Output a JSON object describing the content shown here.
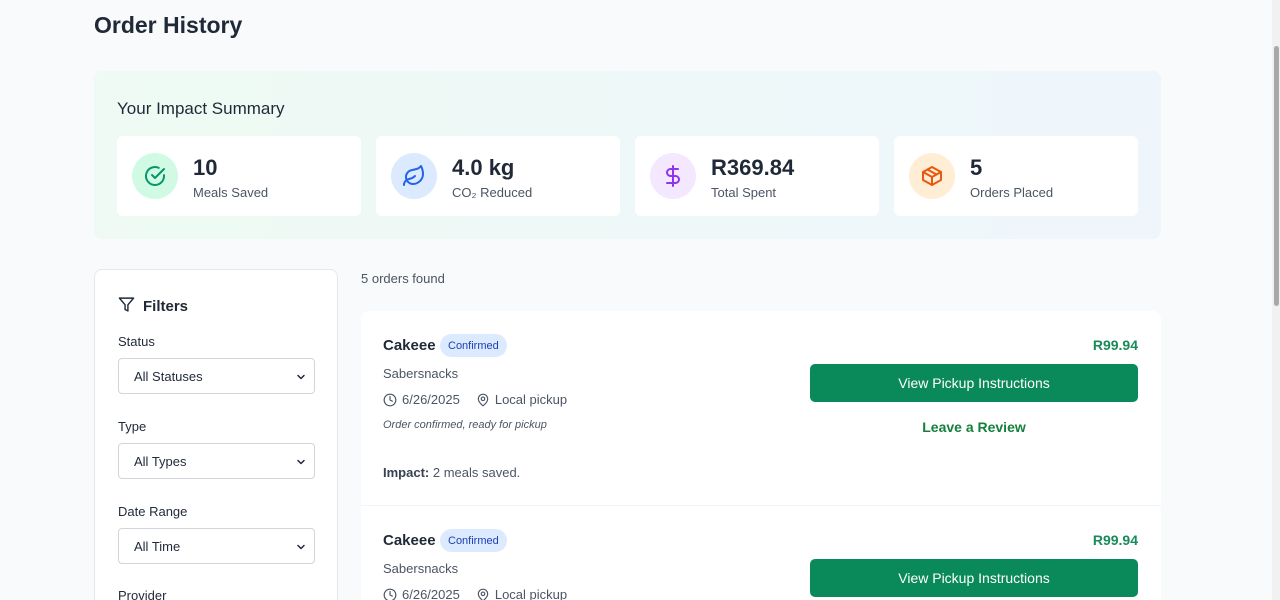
{
  "page": {
    "title": "Order History"
  },
  "impact": {
    "title": "Your Impact Summary",
    "stats": [
      {
        "value": "10",
        "label": "Meals Saved",
        "icon": "check-circle-icon",
        "bg": "#d1fae5",
        "fg": "#059669"
      },
      {
        "value": "4.0 kg",
        "label": "CO₂ Reduced",
        "icon": "leaf-icon",
        "bg": "#dbeafe",
        "fg": "#2563eb"
      },
      {
        "value": "R369.84",
        "label": "Total Spent",
        "icon": "dollar-icon",
        "bg": "#f3e8ff",
        "fg": "#9333ea"
      },
      {
        "value": "5",
        "label": "Orders Placed",
        "icon": "package-icon",
        "bg": "#ffedd5",
        "fg": "#ea580c"
      }
    ]
  },
  "filters": {
    "title": "Filters",
    "status": {
      "label": "Status",
      "value": "All Statuses"
    },
    "type": {
      "label": "Type",
      "value": "All Types"
    },
    "date_range": {
      "label": "Date Range",
      "value": "All Time"
    },
    "provider": {
      "label": "Provider"
    }
  },
  "orders": {
    "count_text": "5 orders found",
    "items": [
      {
        "name": "Cakeee",
        "status": "Confirmed",
        "provider": "Sabersnacks",
        "date": "6/26/2025",
        "method": "Local pickup",
        "note": "Order confirmed, ready for pickup",
        "impact_label": "Impact:",
        "impact_text": "2 meals saved.",
        "price": "R99.94",
        "primary_action": "View Pickup Instructions",
        "secondary_action": "Leave a Review"
      },
      {
        "name": "Cakeee",
        "status": "Confirmed",
        "provider": "Sabersnacks",
        "date": "6/26/2025",
        "method": "Local pickup",
        "price": "R99.94",
        "primary_action": "View Pickup Instructions"
      }
    ]
  }
}
